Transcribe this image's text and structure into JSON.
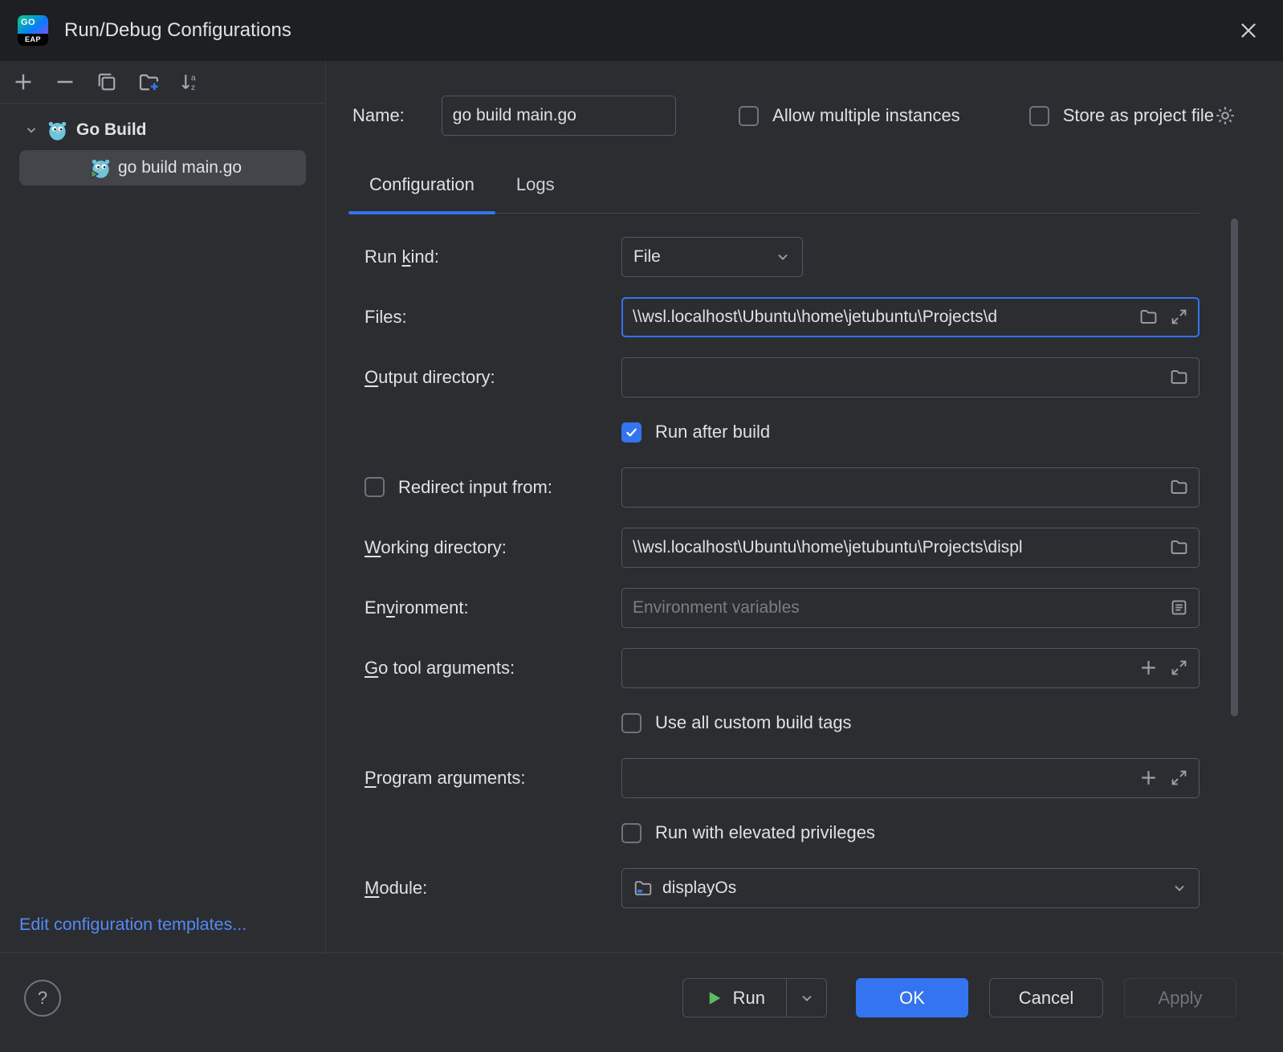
{
  "window": {
    "title": "Run/Debug Configurations",
    "logo": {
      "line1": "GO",
      "line2": "EAP"
    }
  },
  "sidebar": {
    "toolbar": {
      "add": "add",
      "remove": "remove",
      "copy": "copy-configuration",
      "new_folder": "new-folder",
      "sort": "sort-configurations"
    },
    "tree": {
      "group": {
        "label": "Go Build"
      },
      "selected_item": {
        "label": "go build main.go"
      }
    },
    "edit_templates_link": "Edit configuration templates..."
  },
  "header": {
    "name_label": "Name:",
    "name_value": "go build main.go",
    "allow_multiple_instances": {
      "label": "Allow multiple instances",
      "checked": false
    },
    "store_as_project_file": {
      "label": "Store as project file",
      "checked": false
    }
  },
  "tabs": {
    "configuration": "Configuration",
    "logs": "Logs"
  },
  "form": {
    "run_kind": {
      "label": {
        "text": "Run kind:",
        "mnemonic": "k"
      },
      "value": "File"
    },
    "files": {
      "label": {
        "text": "Files:"
      },
      "value": "\\\\wsl.localhost\\Ubuntu\\home\\jetubuntu\\Projects\\d"
    },
    "output_directory": {
      "label": {
        "text": "Output directory:",
        "mnemonic": "O"
      },
      "value": ""
    },
    "run_after_build": {
      "label": "Run after build",
      "checked": true
    },
    "redirect_input": {
      "label": "Redirect input from:",
      "checked": false,
      "value": ""
    },
    "working_directory": {
      "label": {
        "text": "Working directory:",
        "mnemonic": "W"
      },
      "value": "\\\\wsl.localhost\\Ubuntu\\home\\jetubuntu\\Projects\\displ"
    },
    "environment": {
      "label": {
        "text": "Environment:",
        "mnemonic": "v"
      },
      "placeholder": "Environment variables"
    },
    "go_tool_arguments": {
      "label": {
        "text": "Go tool arguments:",
        "mnemonic": "G"
      },
      "value": ""
    },
    "use_all_custom_build_tags": {
      "label": "Use all custom build tags",
      "checked": false
    },
    "program_arguments": {
      "label": {
        "text": "Program arguments:",
        "mnemonic": "P"
      },
      "value": ""
    },
    "run_with_elevated_privileges": {
      "label": "Run with elevated privileges",
      "checked": false
    },
    "module": {
      "label": {
        "text": "Module:",
        "mnemonic": "M"
      },
      "value": "displayOs"
    }
  },
  "footer": {
    "help": "?",
    "run": "Run",
    "ok": "OK",
    "cancel": "Cancel",
    "apply": "Apply",
    "apply_disabled": true
  },
  "icons": {
    "folder": "folder-outline",
    "expand": "expand-field-diagonal-arrows",
    "plus": "plus",
    "list": "environment-variables-list",
    "gear": "settings-gear",
    "chevron_down": "chevron-down",
    "play": "green-play-triangle",
    "close": "close-x",
    "go_gopher": "go-gopher",
    "go_gopher_run": "go-gopher-with-run-overlay",
    "copy": "copy",
    "new_folder": "folder-with-plus",
    "sort": "sort-alphabetically",
    "help": "question-mark-circle"
  },
  "colors": {
    "accent": "#3574F0",
    "link": "#548AF7",
    "run_green": "#5FB865",
    "background": "#2B2D30",
    "titlebar": "#1E1F22"
  }
}
